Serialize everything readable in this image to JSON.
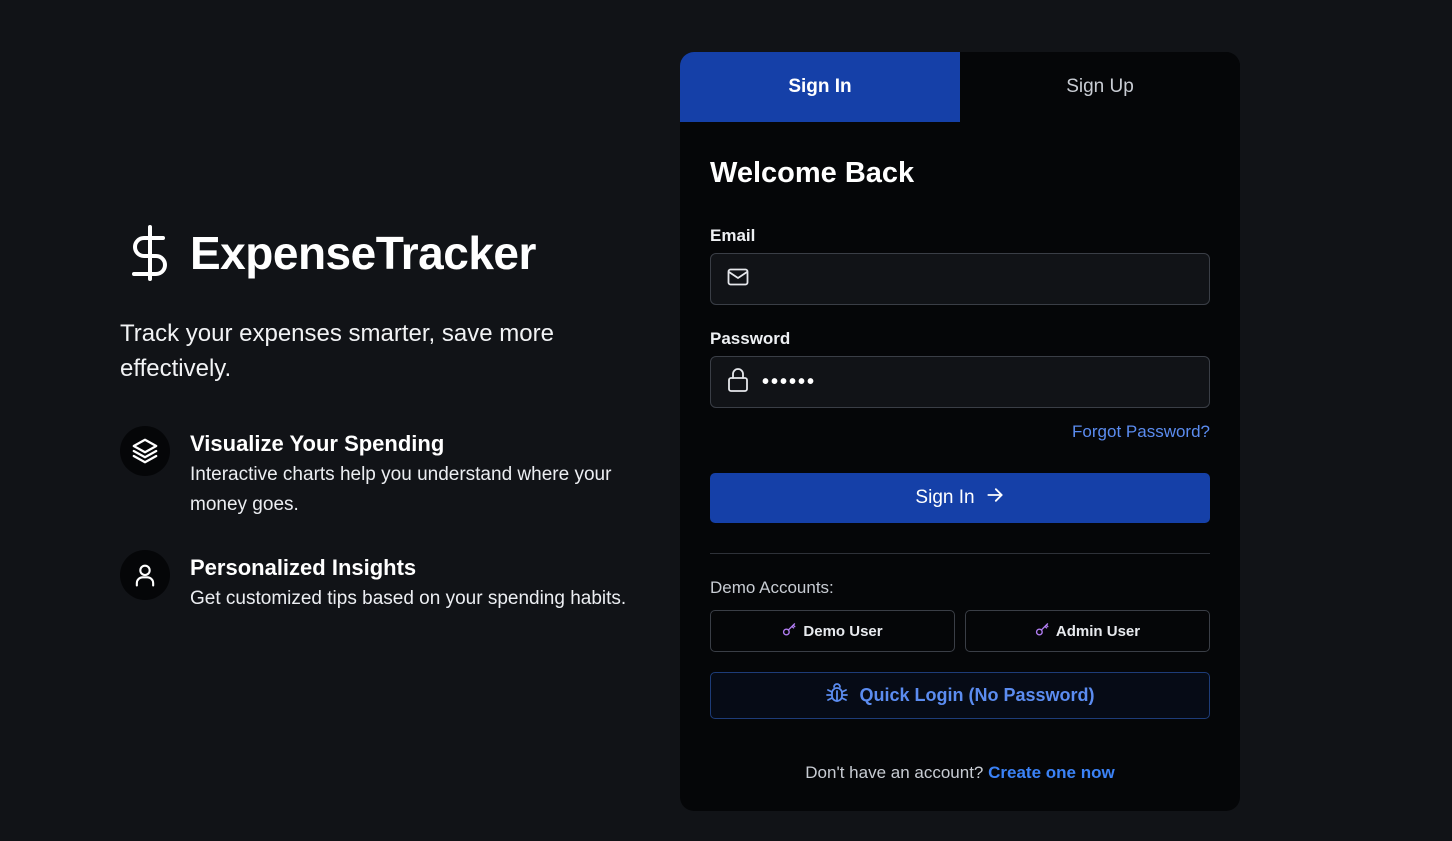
{
  "brand": {
    "icon": "dollar-sign-icon",
    "name": "ExpenseTracker",
    "tagline": "Track your expenses smarter, save more effectively."
  },
  "features": [
    {
      "icon": "layers-icon",
      "title": "Visualize Your Spending",
      "description": "Interactive charts help you understand where your money goes."
    },
    {
      "icon": "user-icon",
      "title": "Personalized Insights",
      "description": "Get customized tips based on your spending habits."
    }
  ],
  "auth": {
    "tabs": [
      {
        "label": "Sign In",
        "active": true
      },
      {
        "label": "Sign Up",
        "active": false
      }
    ],
    "heading": "Welcome Back",
    "email": {
      "label": "Email",
      "icon": "mail-icon",
      "value": "",
      "placeholder": ""
    },
    "password": {
      "label": "Password",
      "icon": "lock-icon",
      "value": "••••••"
    },
    "forgot_label": "Forgot Password?",
    "submit_label": "Sign In",
    "submit_icon": "arrow-right-icon",
    "demo": {
      "label": "Demo Accounts:",
      "accounts": [
        {
          "label": "Demo User",
          "icon": "key-icon"
        },
        {
          "label": "Admin User",
          "icon": "key-icon"
        }
      ],
      "quick_login_label": "Quick Login (No Password)",
      "quick_login_icon": "bug-icon"
    },
    "footer": {
      "prompt": "Don't have an account?",
      "link_label": "Create one now"
    }
  },
  "colors": {
    "background": "#111317",
    "card": "#050608",
    "primary": "#1540a8",
    "link": "#3b82f6",
    "key_icon": "#b07cf0"
  }
}
